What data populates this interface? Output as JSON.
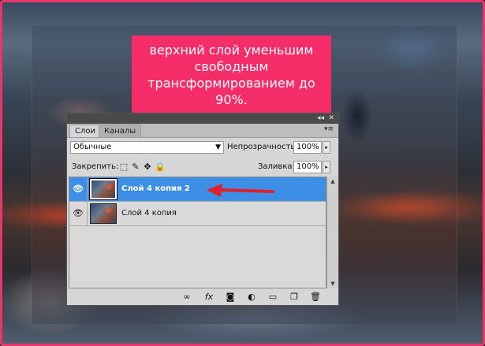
{
  "caption": {
    "line1": "верхний слой уменьшим",
    "line2": "свободным",
    "line3": "трансформированием до",
    "line4": "90%."
  },
  "panel": {
    "titlebar_controls": [
      "◂◂",
      "✕"
    ],
    "tabs": [
      {
        "label": "Слои",
        "active": true
      },
      {
        "label": "Каналы",
        "active": false
      }
    ],
    "menu_icon": "panel-menu-icon",
    "blend_mode": "Обычные",
    "opacity_label": "Непрозрачность:",
    "opacity_value": "100%",
    "lock_label": "Закрепить:",
    "fill_label": "Заливка:",
    "fill_value": "100%",
    "layers": [
      {
        "name": "Слой 4 копия 2",
        "selected": true,
        "visible": true
      },
      {
        "name": "Слой 4 копия",
        "selected": false,
        "visible": true
      }
    ],
    "bottom_icons": [
      "link-icon",
      "fx-icon",
      "mask-icon",
      "adjustment-icon",
      "folder-icon",
      "new-layer-icon",
      "trash-icon"
    ]
  },
  "colors": {
    "caption_bg": "#f42d68",
    "selection": "#3d8fe6",
    "frame_border": "#e8366a",
    "arrow": "#e0202a"
  }
}
